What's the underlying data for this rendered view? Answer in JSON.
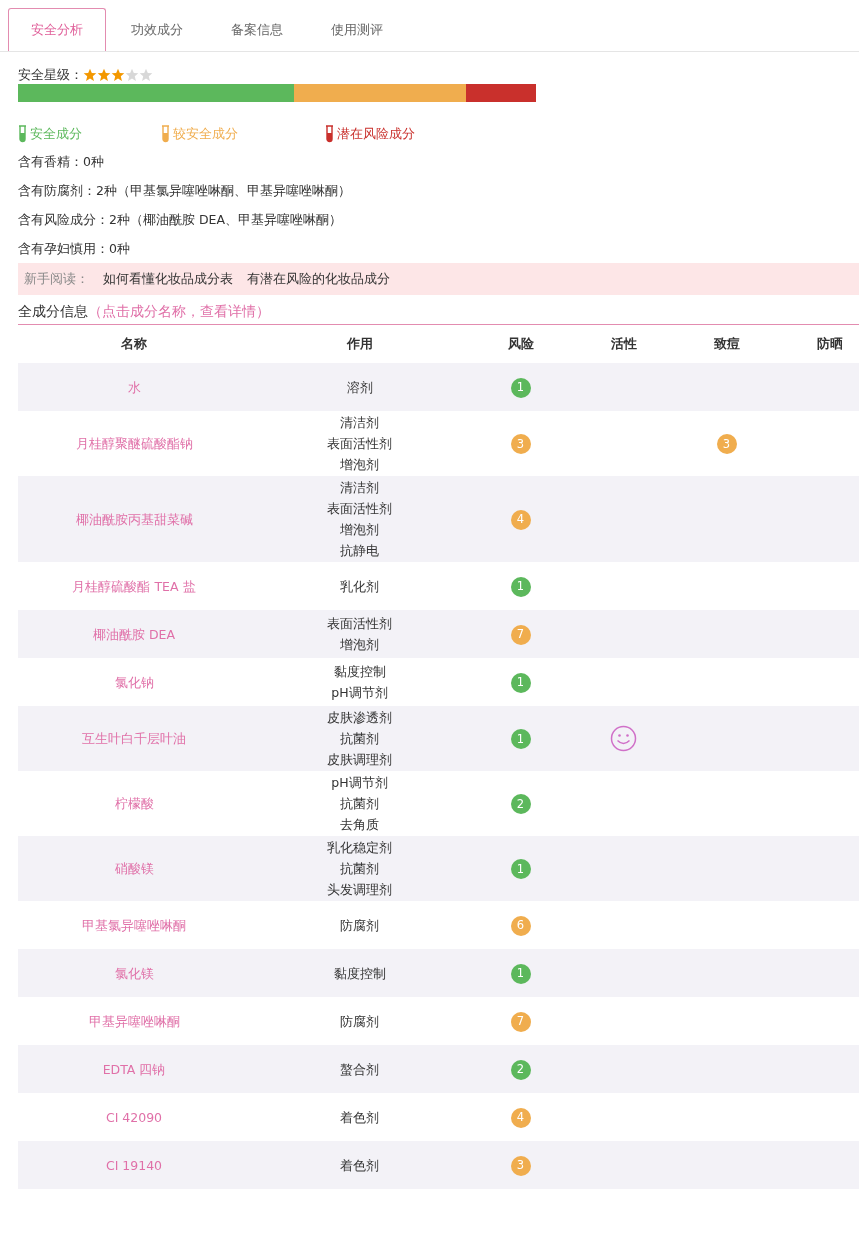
{
  "tabs": [
    {
      "label": "安全分析",
      "selected": true
    },
    {
      "label": "功效成分",
      "selected": false
    },
    {
      "label": "备案信息",
      "selected": false
    },
    {
      "label": "使用测评",
      "selected": false
    }
  ],
  "safety": {
    "label": "安全星级：",
    "stars": 3,
    "legend": [
      {
        "label": "安全成分",
        "color": "#5cb85c"
      },
      {
        "label": "较安全成分",
        "color": "#f0ad4e"
      },
      {
        "label": "潜在风险成分",
        "color": "#c9302c"
      }
    ],
    "facts": [
      "含有香精：0种",
      "含有防腐剂：2种（甲基氯异噻唑啉酮、甲基异噻唑啉酮）",
      "含有风险成分：2种（椰油酰胺 DEA、甲基异噻唑啉酮）",
      "含有孕妇慎用：0种"
    ]
  },
  "reading": {
    "label": "新手阅读：",
    "links": [
      "如何看懂化妆品成分表",
      "有潜在风险的化妆品成分"
    ]
  },
  "ingredients": {
    "title": "全成分信息",
    "hint": "（点击成分名称，查看详情）",
    "columns": [
      "名称",
      "作用",
      "风险",
      "活性",
      "致痘",
      "防晒"
    ],
    "rows": [
      {
        "name": "水",
        "functions": [
          "溶剂"
        ],
        "risk": {
          "value": "1",
          "color": "#5cb85c"
        },
        "active": false
      },
      {
        "name": "月桂醇聚醚硫酸酯钠",
        "functions": [
          "清洁剂",
          "表面活性剂",
          "增泡剂"
        ],
        "risk": {
          "value": "3",
          "color": "#f0ad4e"
        },
        "active": false,
        "acne": {
          "value": "3",
          "color": "#f0ad4e"
        }
      },
      {
        "name": "椰油酰胺丙基甜菜碱",
        "functions": [
          "清洁剂",
          "表面活性剂",
          "增泡剂",
          "抗静电"
        ],
        "risk": {
          "value": "4",
          "color": "#f0ad4e"
        },
        "active": false
      },
      {
        "name": "月桂醇硫酸酯 TEA 盐",
        "functions": [
          "乳化剂"
        ],
        "risk": {
          "value": "1",
          "color": "#5cb85c"
        },
        "active": false
      },
      {
        "name": "椰油酰胺 DEA",
        "functions": [
          "表面活性剂",
          "增泡剂"
        ],
        "risk": {
          "value": "7",
          "color": "#f0ad4e"
        },
        "active": false
      },
      {
        "name": "氯化钠",
        "functions": [
          "黏度控制",
          "pH调节剂"
        ],
        "risk": {
          "value": "1",
          "color": "#5cb85c"
        },
        "active": false
      },
      {
        "name": "互生叶白千层叶油",
        "functions": [
          "皮肤渗透剂",
          "抗菌剂",
          "皮肤调理剂"
        ],
        "risk": {
          "value": "1",
          "color": "#5cb85c"
        },
        "active": true
      },
      {
        "name": "柠檬酸",
        "functions": [
          "pH调节剂",
          "抗菌剂",
          "去角质"
        ],
        "risk": {
          "value": "2",
          "color": "#5cb85c"
        },
        "active": false
      },
      {
        "name": "硝酸镁",
        "functions": [
          "乳化稳定剂",
          "抗菌剂",
          "头发调理剂"
        ],
        "risk": {
          "value": "1",
          "color": "#5cb85c"
        },
        "active": false
      },
      {
        "name": "甲基氯异噻唑啉酮",
        "functions": [
          "防腐剂"
        ],
        "risk": {
          "value": "6",
          "color": "#f0ad4e"
        },
        "active": false
      },
      {
        "name": "氯化镁",
        "functions": [
          "黏度控制"
        ],
        "risk": {
          "value": "1",
          "color": "#5cb85c"
        },
        "active": false
      },
      {
        "name": "甲基异噻唑啉酮",
        "functions": [
          "防腐剂"
        ],
        "risk": {
          "value": "7",
          "color": "#f0ad4e"
        },
        "active": false
      },
      {
        "name": "EDTA 四钠",
        "functions": [
          "螯合剂"
        ],
        "risk": {
          "value": "2",
          "color": "#5cb85c"
        },
        "active": false
      },
      {
        "name": "CI 42090",
        "functions": [
          "着色剂"
        ],
        "risk": {
          "value": "4",
          "color": "#f0ad4e"
        },
        "active": false
      },
      {
        "name": "CI 19140",
        "functions": [
          "着色剂"
        ],
        "risk": {
          "value": "3",
          "color": "#f0ad4e"
        },
        "active": false
      }
    ]
  }
}
